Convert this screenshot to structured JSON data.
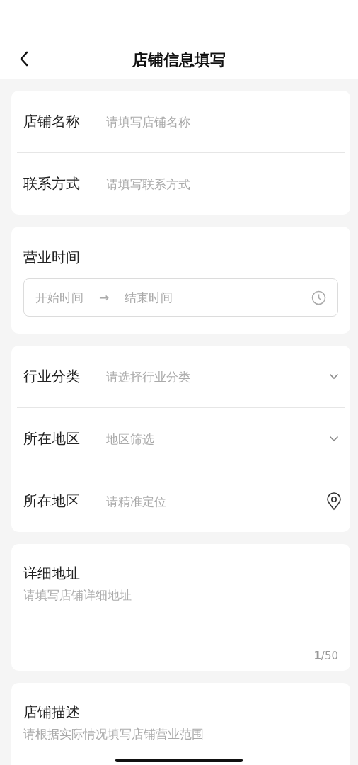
{
  "header": {
    "title": "店铺信息填写"
  },
  "sections": [
    {
      "kind": "rows",
      "rows": [
        {
          "kind": "input",
          "label": "店铺名称",
          "placeholder": "请填写店铺名称"
        },
        {
          "kind": "input",
          "label": "联系方式",
          "placeholder": "请填写联系方式"
        }
      ]
    },
    {
      "kind": "time_range",
      "label": "营业时间",
      "start_placeholder": "开始时间",
      "separator": "→",
      "end_placeholder": "结束时间"
    },
    {
      "kind": "rows",
      "rows": [
        {
          "kind": "select",
          "label": "行业分类",
          "placeholder": "请选择行业分类"
        },
        {
          "kind": "select",
          "label": "所在地区",
          "placeholder": "地区筛选"
        },
        {
          "kind": "location",
          "label": "所在地区",
          "placeholder": "请精准定位"
        }
      ]
    },
    {
      "kind": "textarea",
      "label": "详细地址",
      "placeholder": "请填写店铺详细地址",
      "counter": "**1**/50"
    },
    {
      "kind": "textarea",
      "label": "店铺描述",
      "placeholder": "请根据实际情况填写店铺营业范围"
    }
  ]
}
